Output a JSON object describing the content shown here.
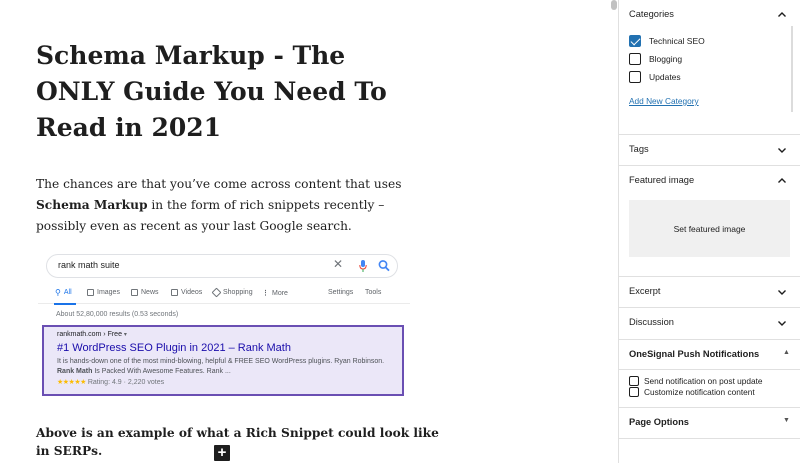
{
  "editor": {
    "title": "Schema Markup - The ONLY Guide You Need To Read in 2021",
    "para_part1": "The chances are that you’ve come across content that uses ",
    "para_bold": "Schema Markup",
    "para_part2": " in the form of rich snippets recently – possibly even as recent as your last Google search.",
    "caption": "Above is an example of what a Rich Snippet could look like in SERPs.",
    "add_block_symbol": "+"
  },
  "serp": {
    "query": "rank math suite",
    "clear_symbol": "✕",
    "tabs": [
      {
        "label": "All",
        "icon": "search-icon"
      },
      {
        "label": "Images",
        "icon": "image-icon"
      },
      {
        "label": "News",
        "icon": "news-icon"
      },
      {
        "label": "Videos",
        "icon": "video-icon"
      },
      {
        "label": "Shopping",
        "icon": "tag-icon"
      },
      {
        "label": "More",
        "icon": "more-dots-icon"
      },
      {
        "label": "Settings",
        "icon": ""
      },
      {
        "label": "Tools",
        "icon": ""
      }
    ],
    "stats": "About 52,80,000 results (0.53 seconds)",
    "result": {
      "cite": "rankmath.com › Free",
      "cite_arrow": "▾",
      "title": "#1 WordPress SEO Plugin in 2021 – Rank Math",
      "snippet_1": "It is hands-down one of the most mind-blowing, helpful & FREE SEO WordPress plugins. Ryan Robinson. ",
      "snippet_bold": "Rank Math",
      "snippet_2": " Is Packed With Awesome Features. Rank ...",
      "stars": "★★★★★",
      "rating": "Rating: 4.9 · 2,220 votes"
    },
    "colors": {
      "link": "#1a0dab",
      "highlight_border": "#6a4fb3",
      "highlight_bg": "#ebe7f8",
      "stars": "#fbbc04"
    }
  },
  "sidebar": {
    "categories": {
      "title": "Categories",
      "items": [
        {
          "label": "Technical SEO",
          "checked": true
        },
        {
          "label": "Blogging",
          "checked": false
        },
        {
          "label": "Updates",
          "checked": false
        }
      ],
      "add_new": "Add New Category"
    },
    "tags": {
      "title": "Tags"
    },
    "featured_image": {
      "title": "Featured image",
      "button": "Set featured image"
    },
    "excerpt": {
      "title": "Excerpt"
    },
    "discussion": {
      "title": "Discussion"
    },
    "onesignal": {
      "title": "OneSignal Push Notifications",
      "options": [
        {
          "label": "Send notification on post update",
          "checked": false
        },
        {
          "label": "Customize notification content",
          "checked": false
        }
      ]
    },
    "page_options": {
      "title": "Page Options"
    },
    "accent_color": "#2271b1"
  }
}
